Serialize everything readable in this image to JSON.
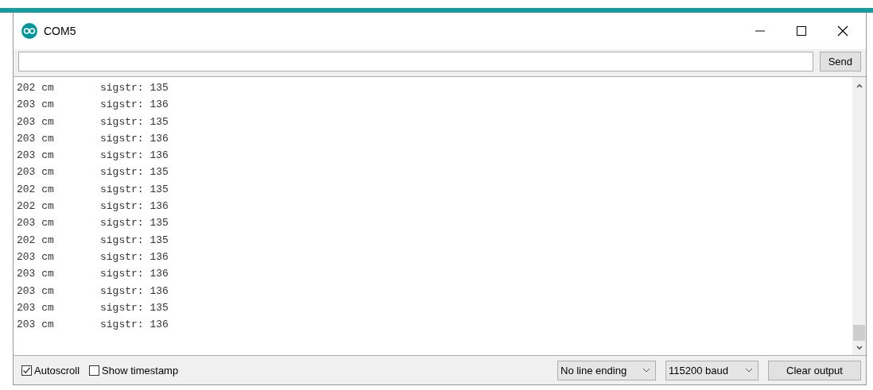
{
  "window": {
    "title": "COM5"
  },
  "input": {
    "send_label": "Send"
  },
  "output": {
    "lines": [
      {
        "distance": "202 cm",
        "signal": "sigstr: 135"
      },
      {
        "distance": "203 cm",
        "signal": "sigstr: 136"
      },
      {
        "distance": "203 cm",
        "signal": "sigstr: 135"
      },
      {
        "distance": "203 cm",
        "signal": "sigstr: 136"
      },
      {
        "distance": "203 cm",
        "signal": "sigstr: 136"
      },
      {
        "distance": "203 cm",
        "signal": "sigstr: 135"
      },
      {
        "distance": "202 cm",
        "signal": "sigstr: 135"
      },
      {
        "distance": "202 cm",
        "signal": "sigstr: 136"
      },
      {
        "distance": "203 cm",
        "signal": "sigstr: 135"
      },
      {
        "distance": "202 cm",
        "signal": "sigstr: 135"
      },
      {
        "distance": "203 cm",
        "signal": "sigstr: 136"
      },
      {
        "distance": "203 cm",
        "signal": "sigstr: 136"
      },
      {
        "distance": "203 cm",
        "signal": "sigstr: 136"
      },
      {
        "distance": "203 cm",
        "signal": "sigstr: 135"
      },
      {
        "distance": "203 cm",
        "signal": "sigstr: 136"
      }
    ]
  },
  "options": [
    {
      "label": "Autoscroll",
      "checked": true
    },
    {
      "label": "Show timestamp",
      "checked": false
    }
  ],
  "line_ending": "No line ending",
  "baud": "115200 baud",
  "clear_label": "Clear output"
}
